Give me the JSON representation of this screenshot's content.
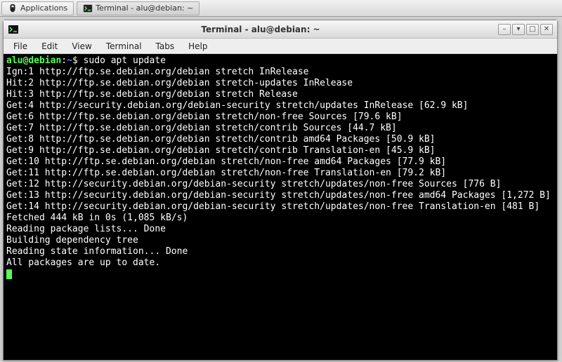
{
  "taskbar": {
    "applications_label": "Applications",
    "task_label": "Terminal - alu@debian: ~"
  },
  "window": {
    "title": "Terminal - alu@debian: ~"
  },
  "menubar": {
    "file": "File",
    "edit": "Edit",
    "view": "View",
    "terminal": "Terminal",
    "tabs": "Tabs",
    "help": "Help"
  },
  "prompt": {
    "user_host": "alu@debian",
    "sep1": ":",
    "path": "~",
    "sep2": "$ ",
    "command": "sudo apt update"
  },
  "output_lines": [
    "Ign:1 http://ftp.se.debian.org/debian stretch InRelease",
    "Hit:2 http://ftp.se.debian.org/debian stretch-updates InRelease",
    "Hit:3 http://ftp.se.debian.org/debian stretch Release",
    "Get:4 http://security.debian.org/debian-security stretch/updates InRelease [62.9 kB]",
    "Get:6 http://ftp.se.debian.org/debian stretch/non-free Sources [79.6 kB]",
    "Get:7 http://ftp.se.debian.org/debian stretch/contrib Sources [44.7 kB]",
    "Get:8 http://ftp.se.debian.org/debian stretch/contrib amd64 Packages [50.9 kB]",
    "Get:9 http://ftp.se.debian.org/debian stretch/contrib Translation-en [45.9 kB]",
    "Get:10 http://ftp.se.debian.org/debian stretch/non-free amd64 Packages [77.9 kB]",
    "Get:11 http://ftp.se.debian.org/debian stretch/non-free Translation-en [79.2 kB]",
    "Get:12 http://security.debian.org/debian-security stretch/updates/non-free Sources [776 B]",
    "Get:13 http://security.debian.org/debian-security stretch/updates/non-free amd64 Packages [1,272 B]",
    "Get:14 http://security.debian.org/debian-security stretch/updates/non-free Translation-en [481 B]",
    "Fetched 444 kB in 0s (1,085 kB/s)",
    "Reading package lists... Done",
    "Building dependency tree",
    "Reading state information... Done",
    "All packages are up to date."
  ]
}
